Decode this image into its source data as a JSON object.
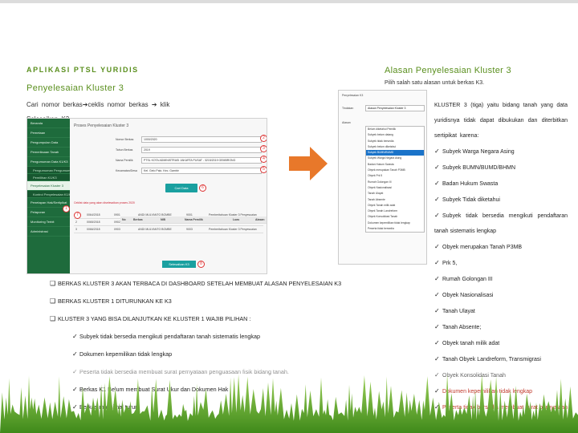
{
  "header": {
    "app_title": "APLIKASI PTSL YURIDIS",
    "section_title": "Penyelesaian Kluster 3",
    "instruction": "Cari nomor berkas➔ceklis nomor berkas ➔ klik Selesaikan K3"
  },
  "right_header": {
    "title": "Alasan Penyelesaian Kluster 3",
    "subtitle": "Pilih salah satu alasan untuk berkas K3."
  },
  "screenshot": {
    "page_heading": "Proses Penyelesaian Kluster 3",
    "sidebar": [
      {
        "label": "Beranda",
        "type": "main"
      },
      {
        "label": "Pemetaan",
        "type": "main"
      },
      {
        "label": "Pengumpulan Data",
        "type": "main"
      },
      {
        "label": "Pemeriksaan Tanah",
        "type": "main"
      },
      {
        "label": "Pengumuman Data K1/K3",
        "type": "main"
      },
      {
        "label": "Pengumuman Pengumuman",
        "type": "sub"
      },
      {
        "label": "Pemilihan K1/K3",
        "type": "sub"
      },
      {
        "label": "Penyelesaian Kluster 3",
        "type": "active"
      },
      {
        "label": "Kontrol Penyelesaian K1/K3",
        "type": "sub"
      },
      {
        "label": "Penetapan Hak/Sertipikat",
        "type": "main"
      },
      {
        "label": "Pelaporan",
        "type": "main"
      },
      {
        "label": "Monitoring Terbit",
        "type": "main"
      },
      {
        "label": "Administrasi",
        "type": "main"
      }
    ],
    "form": [
      {
        "label": "Nomor Berkas",
        "value": "1000/2020"
      },
      {
        "label": "Tahun Berkas",
        "value": "2019"
      },
      {
        "label": "Nama Pemilik",
        "value": "PTSL KOTA ADMINISTRASI JAKARTA PUSAT - 3215/2019 GEMBRONG"
      },
      {
        "label": "Kecamatan/Desa",
        "value": "Kel. Gelo Palo. Kec. Gambir"
      }
    ],
    "search_button": "Cari Data",
    "hint": "Ceklist data yang akan diselesaikan proses 2020",
    "table_headers": [
      "No",
      "Berkas",
      "NIB",
      "Nama Pemilik",
      "Luas",
      "Alasan"
    ],
    "table_rows": [
      [
        "1",
        "0064/2018",
        "0901",
        "ANDI MULYANTO BOMBE",
        "9001",
        "Pemberitahuan Kluster 3 Penyesuaian"
      ],
      [
        "2",
        "0065/2018",
        "0902",
        "ANDI MULYANTO BOMBE",
        "9002",
        "Pemberitahuan Kluster 3 Penyesuaian"
      ],
      [
        "3",
        "0066/2018",
        "0903",
        "ANDI MULYANTO BOMBE",
        "9003",
        "Pemberitahuan Kluster 3 Penyesuaian"
      ]
    ],
    "submit_button": "Selesaikan K3",
    "badges": [
      "1",
      "2",
      "3",
      "4",
      "5",
      "6",
      "7",
      "8"
    ]
  },
  "dropdown_panel": {
    "label_top": "Penyelesaian K3",
    "label_select": "Tindakan",
    "label_reason": "Alasan",
    "selected": "Alasan Penyelesaian Kluster 3",
    "options": [
      "Belum diketahui Pemilik",
      "Subyek belum datang",
      "Subyek tidak bersedia",
      "Subyek belum diketahui",
      "Subyek BUMN/BUMD",
      "Subyek Warga Negara Asing",
      "Badan Hukum Swasta",
      "Obyek merupakan Tanah P3MB",
      "Obyek Prk 5",
      "Rumah Golongan III",
      "Obyek Nasionalisasi",
      "Tanah Ulayat",
      "Tanah Absente",
      "Obyek Tanah milik adat",
      "Obyek Tanah Landreform",
      "Obyek Konsolidasi Tanah",
      "Dokumen kepemilikan tidak lengkap",
      "Peserta tidak bersedia"
    ],
    "selected_index": 4
  },
  "kluster_reasons": {
    "intro": "KLUSTER 3 (tiga) yaitu bidang tanah yang data yuridisnya tidak dapat dibukukan dan diterbitkan sertipikat karena:",
    "items": [
      {
        "text": "Subyek Warga Negara Asing",
        "red": false,
        "wrap": false
      },
      {
        "text": "Subyek BUMN/BUMD/BHMN",
        "red": false,
        "wrap": false
      },
      {
        "text": "Badan Hukum Swasta",
        "red": false,
        "wrap": false
      },
      {
        "text": "Subyek Tidak diketahui",
        "red": false,
        "wrap": false
      },
      {
        "text": "Subyek tidak bersedia mengikuti pendaftaran tanah sistematis lengkap",
        "red": false,
        "wrap": true
      },
      {
        "text": "Obyek merupakan Tanah P3MB",
        "red": false,
        "wrap": false
      },
      {
        "text": "Prk 5,",
        "red": false,
        "wrap": false
      },
      {
        "text": "Rumah Golongan III",
        "red": false,
        "wrap": false
      },
      {
        "text": "Obyek Nasionalisasi",
        "red": false,
        "wrap": false
      },
      {
        "text": "Tanah Ulayat",
        "red": false,
        "wrap": false
      },
      {
        "text": "Tanah Absente;",
        "red": false,
        "wrap": false
      },
      {
        "text": "Obyek tanah milik adat",
        "red": false,
        "wrap": false
      },
      {
        "text": "Tanah Obyek Landreform, Transmigrasi",
        "red": false,
        "wrap": false
      },
      {
        "text": "Obyek Konsolidasi Tanah",
        "red": false,
        "wrap": false
      },
      {
        "text": "Dokumen kepemilikan tidak lengkap",
        "red": true,
        "wrap": false
      },
      {
        "text": "Peserta tidak bersedia membuat surat pernyataan penguasaan fisik bidang tanah.",
        "red": true,
        "wrap": true
      }
    ]
  },
  "notes": {
    "points": [
      "BERKAS KLUSTER 3 AKAN TERBACA DI DASHBOARD SETELAH MEMBUAT ALASAN PENYELESAIAN K3",
      "BERKAS KLUSTER 1 DITURUNKAN KE K3",
      "KLUSTER 3 YANG BISA DILANJUTKAN KE KLUSTER 1 WAJIB PILIHAN :"
    ],
    "options": [
      "Subyek tidak bersedia mengikuti pendaftaran tanah sistematis lengkap",
      "Dokumen kepemilikan tidak lengkap",
      "Peserta tidak bersedia membuat surat pernyataan penguasaan fisik bidang tanah.",
      "Berkas K1 Belum membuat Surat Ukur dan Dokumen Hak",
      "Berkas maksimal turun"
    ]
  },
  "colors": {
    "accent": "#5a8f1e",
    "sidebar": "#1e6b3c",
    "button": "#1aa0a0",
    "arrow": "#e8782a",
    "highlight": "#1a73c9",
    "red": "#c0392b"
  }
}
